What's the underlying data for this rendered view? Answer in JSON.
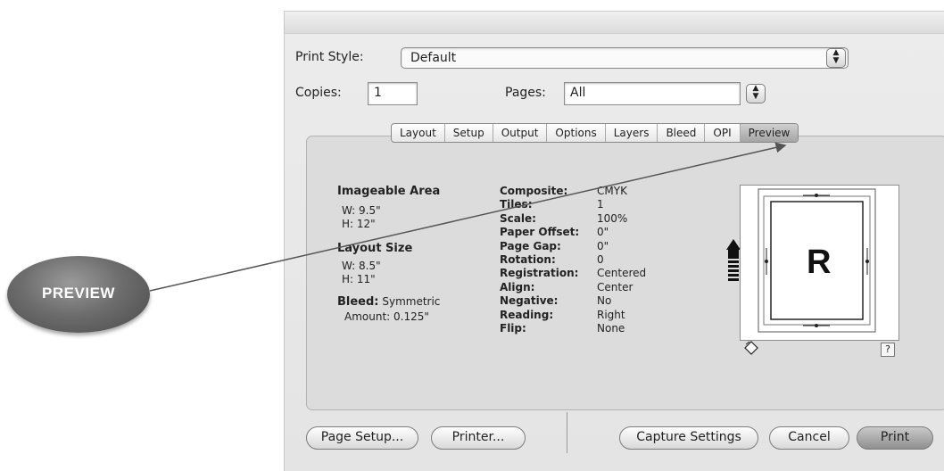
{
  "callout": {
    "label": "PREVIEW"
  },
  "print_style": {
    "label": "Print Style:",
    "value": "Default"
  },
  "copies": {
    "label": "Copies:",
    "value": "1"
  },
  "pages": {
    "label": "Pages:",
    "value": "All"
  },
  "tabs": [
    {
      "label": "Layout"
    },
    {
      "label": "Setup"
    },
    {
      "label": "Output"
    },
    {
      "label": "Options"
    },
    {
      "label": "Layers"
    },
    {
      "label": "Bleed"
    },
    {
      "label": "OPI"
    },
    {
      "label": "Preview",
      "selected": true
    }
  ],
  "imageable_area": {
    "title": "Imageable Area",
    "w": "W: 9.5\"",
    "h": "H: 12\""
  },
  "layout_size": {
    "title": "Layout Size",
    "w": "W: 8.5\"",
    "h": "H: 11\""
  },
  "bleed": {
    "label": "Bleed:",
    "value": "Symmetric",
    "amount": "Amount: 0.125\""
  },
  "details": [
    {
      "label": "Composite:",
      "value": "CMYK"
    },
    {
      "label": "Tiles:",
      "value": "1"
    },
    {
      "label": "Scale:",
      "value": "100%"
    },
    {
      "label": "Paper Offset:",
      "value": "0\""
    },
    {
      "label": "Page Gap:",
      "value": "0\""
    },
    {
      "label": "Rotation:",
      "value": "0"
    },
    {
      "label": "Registration:",
      "value": "Centered"
    },
    {
      "label": "Align:",
      "value": "Center"
    },
    {
      "label": "Negative:",
      "value": "No"
    },
    {
      "label": "Reading:",
      "value": "Right"
    },
    {
      "label": "Flip:",
      "value": "None"
    }
  ],
  "preview": {
    "letter": "R",
    "help": "?"
  },
  "buttons": {
    "page_setup": "Page Setup...",
    "printer": "Printer...",
    "capture": "Capture Settings",
    "cancel": "Cancel",
    "print": "Print"
  },
  "icons": {
    "stepper": "up-down-arrows-icon",
    "feed_direction": "paper-feed-arrow-icon",
    "rotate": "paper-rotation-icon"
  }
}
